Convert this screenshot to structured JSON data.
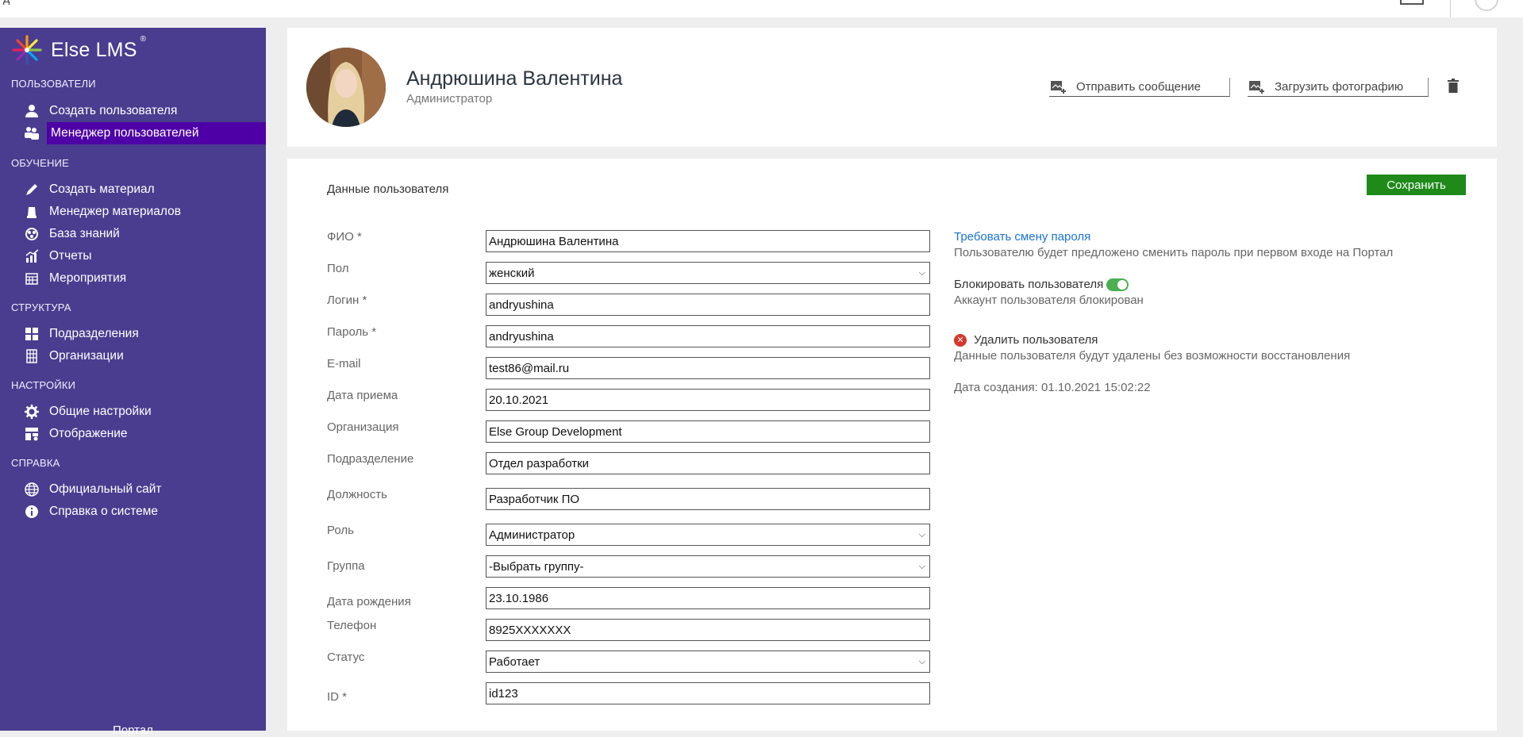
{
  "topbar": {
    "left_glyph": "д"
  },
  "sidebar": {
    "logo_text": "Else LMS",
    "logo_reg": "®",
    "sections": [
      {
        "title": "ПОЛЬЗОВАТЕЛИ",
        "items": [
          {
            "label": "Создать пользователя",
            "icon": "user-icon"
          },
          {
            "label": "Менеджер пользователей",
            "icon": "users-icon",
            "active": true
          }
        ]
      },
      {
        "title": "ОБУЧЕНИЕ",
        "items": [
          {
            "label": "Создать материал",
            "icon": "pencil-icon"
          },
          {
            "label": "Менеджер материалов",
            "icon": "books-icon"
          },
          {
            "label": "База знаний",
            "icon": "knowledge-icon"
          },
          {
            "label": "Отчеты",
            "icon": "chart-icon"
          },
          {
            "label": "Мероприятия",
            "icon": "calendar-icon"
          }
        ]
      },
      {
        "title": "СТРУКТУРА",
        "items": [
          {
            "label": "Подразделения",
            "icon": "departments-icon"
          },
          {
            "label": "Организации",
            "icon": "organization-icon"
          }
        ]
      },
      {
        "title": "НАСТРОЙКИ",
        "items": [
          {
            "label": "Общие настройки",
            "icon": "gear-icon"
          },
          {
            "label": "Отображение",
            "icon": "display-icon"
          }
        ]
      },
      {
        "title": "СПРАВКА",
        "items": [
          {
            "label": "Официальный сайт",
            "icon": "globe-icon"
          },
          {
            "label": "Справка о системе",
            "icon": "info-icon"
          }
        ]
      }
    ],
    "footer": "Портал"
  },
  "profile": {
    "name": "Андрюшина Валентина",
    "role": "Администратор",
    "send_message": "Отправить сообщение",
    "upload_photo": "Загрузить фотографию"
  },
  "form": {
    "title": "Данные пользователя",
    "save": "Сохранить",
    "fields": [
      {
        "label": "ФИО *",
        "value": "Андрюшина Валентина",
        "type": "text"
      },
      {
        "label": "Пол",
        "value": "женский",
        "type": "select"
      },
      {
        "label": "Логин *",
        "value": "andryushina",
        "type": "text"
      },
      {
        "label": "Пароль *",
        "value": "andryushina",
        "type": "text"
      },
      {
        "label": "E-mail",
        "value": "test86@mail.ru",
        "type": "text"
      },
      {
        "label": "Дата приема",
        "value": "20.10.2021",
        "type": "text"
      },
      {
        "label": "Организация",
        "value": "Else Group Development",
        "type": "text"
      },
      {
        "label": "Подразделение",
        "value": "Отдел разработки",
        "type": "text"
      },
      {
        "label": "Должность",
        "value": "Разработчик ПО",
        "type": "text"
      },
      {
        "label": "Роль",
        "value": "Администратор",
        "type": "select"
      },
      {
        "label": "Группа",
        "value": "-Выбрать группу-",
        "type": "select"
      },
      {
        "label": "Дата рождения",
        "value": "23.10.1986",
        "type": "text"
      },
      {
        "label": "Телефон",
        "value": "8925XXXXXXX",
        "type": "text"
      },
      {
        "label": "Статус",
        "value": "Работает",
        "type": "select"
      },
      {
        "label": "ID *",
        "value": "id123",
        "type": "text"
      }
    ]
  },
  "side": {
    "require_password_change": "Требовать смену пароля",
    "require_password_hint": "Пользователю будет предложено сменить пароль при первом входе на Портал",
    "block_user": "Блокировать пользователя",
    "block_on": true,
    "block_hint": "Аккаунт пользователя блокирован",
    "delete_user": "Удалить пользователя",
    "delete_hint": "Данные пользователя будут удалены без возможности восстановления",
    "created": "Дата создания: 01.10.2021 15:02:22"
  },
  "colors": {
    "sidebar": "#4a3d8f",
    "active_item": "#4e00a6",
    "save_button": "#1f8a1a",
    "link": "#1a73d6",
    "toggle_on": "#4caf50",
    "delete_icon": "#d9362b"
  }
}
